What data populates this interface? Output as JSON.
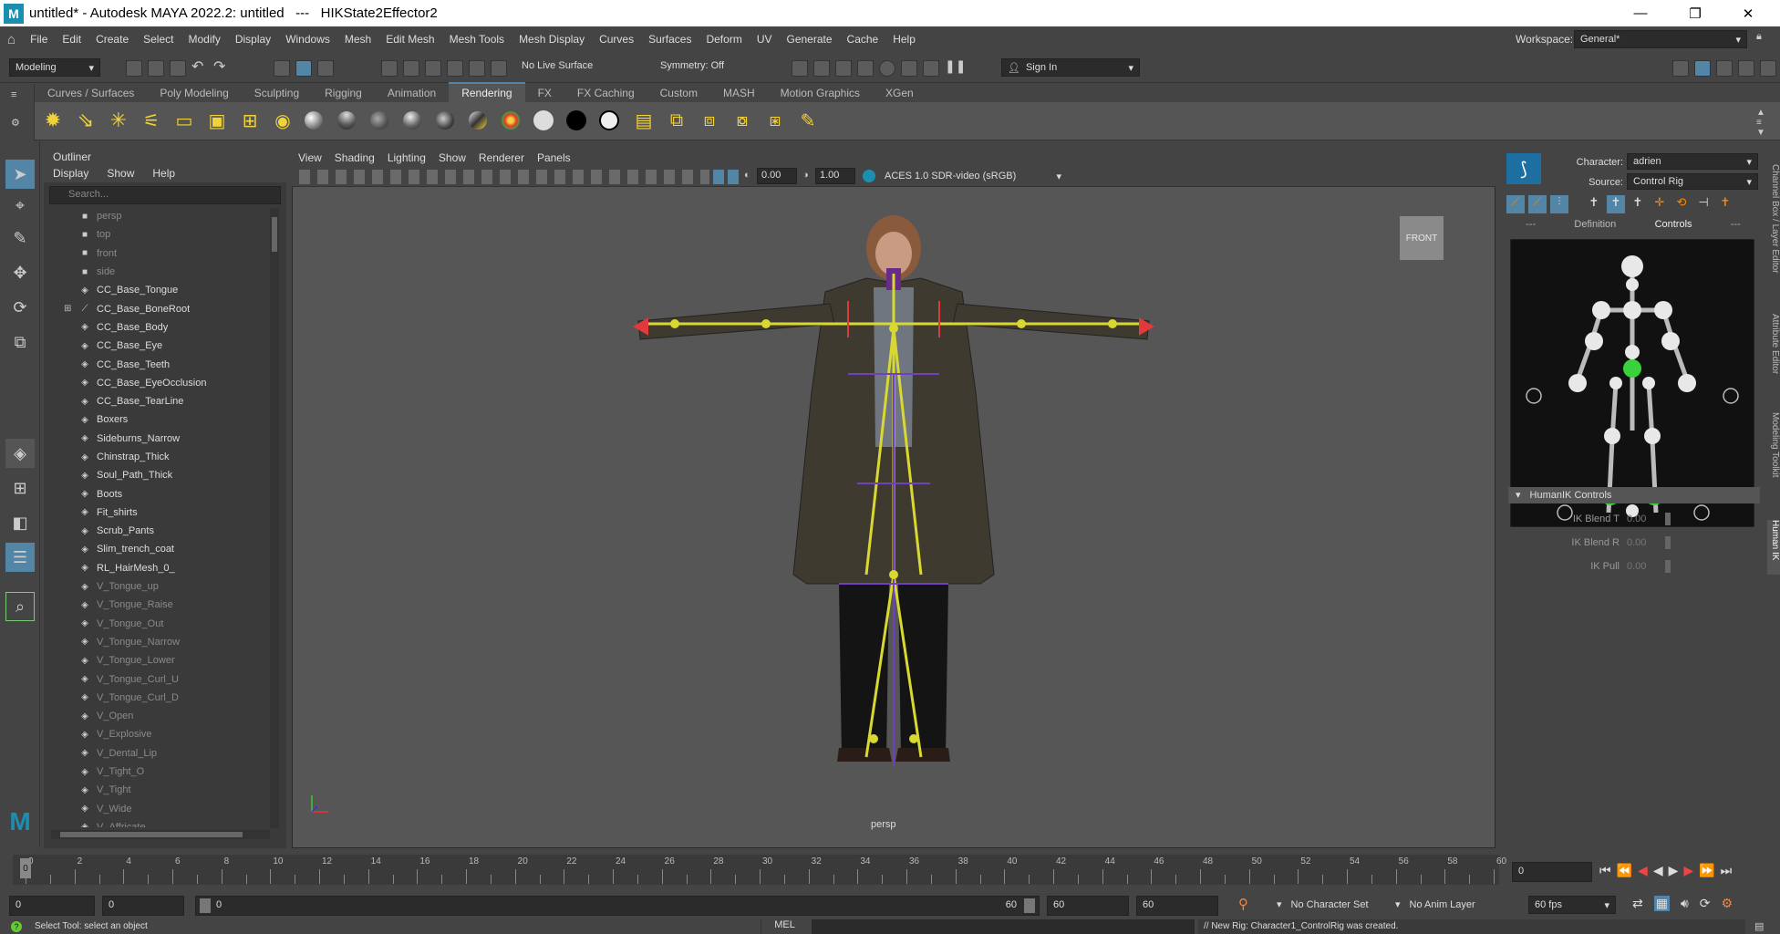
{
  "titlebar": {
    "logo": "M",
    "title": "untitled* - Autodesk MAYA 2022.2: untitled   ---   HIKState2Effector2",
    "minimize": "—",
    "maximize": "❐",
    "close": "✕"
  },
  "menus": [
    "File",
    "Edit",
    "Create",
    "Select",
    "Modify",
    "Display",
    "Windows",
    "Mesh",
    "Edit Mesh",
    "Mesh Tools",
    "Mesh Display",
    "Curves",
    "Surfaces",
    "Deform",
    "UV",
    "Generate",
    "Cache",
    "Help"
  ],
  "workspace": {
    "label": "Workspace:",
    "value": "General*"
  },
  "statusline": {
    "menuset": "Modeling",
    "live_surface": "No Live Surface",
    "symmetry": "Symmetry: Off",
    "sign_in": "Sign In"
  },
  "shelf_tabs": [
    "Curves / Surfaces",
    "Poly Modeling",
    "Sculpting",
    "Rigging",
    "Animation",
    "Rendering",
    "FX",
    "FX Caching",
    "Custom",
    "MASH",
    "Motion Graphics",
    "XGen"
  ],
  "active_shelf_tab": "Rendering",
  "outliner": {
    "title": "Outliner",
    "menu": [
      "Display",
      "Show",
      "Help"
    ],
    "search_placeholder": "Search...",
    "items": [
      {
        "name": "persp",
        "dim": true
      },
      {
        "name": "top",
        "dim": true
      },
      {
        "name": "front",
        "dim": true
      },
      {
        "name": "side",
        "dim": true
      },
      {
        "name": "CC_Base_Tongue"
      },
      {
        "name": "CC_Base_BoneRoot",
        "expand": true
      },
      {
        "name": "CC_Base_Body"
      },
      {
        "name": "CC_Base_Eye"
      },
      {
        "name": "CC_Base_Teeth"
      },
      {
        "name": "CC_Base_EyeOcclusion"
      },
      {
        "name": "CC_Base_TearLine"
      },
      {
        "name": "Boxers"
      },
      {
        "name": "Sideburns_Narrow"
      },
      {
        "name": "Chinstrap_Thick"
      },
      {
        "name": "Soul_Path_Thick"
      },
      {
        "name": "Boots"
      },
      {
        "name": "Fit_shirts"
      },
      {
        "name": "Scrub_Pants"
      },
      {
        "name": "Slim_trench_coat"
      },
      {
        "name": "RL_HairMesh_0_"
      },
      {
        "name": "V_Tongue_up",
        "dim": true
      },
      {
        "name": "V_Tongue_Raise",
        "dim": true
      },
      {
        "name": "V_Tongue_Out",
        "dim": true
      },
      {
        "name": "V_Tongue_Narrow",
        "dim": true
      },
      {
        "name": "V_Tongue_Lower",
        "dim": true
      },
      {
        "name": "V_Tongue_Curl_U",
        "dim": true
      },
      {
        "name": "V_Tongue_Curl_D",
        "dim": true
      },
      {
        "name": "V_Open",
        "dim": true
      },
      {
        "name": "V_Explosive",
        "dim": true
      },
      {
        "name": "V_Dental_Lip",
        "dim": true
      },
      {
        "name": "V_Tight_O",
        "dim": true
      },
      {
        "name": "V_Tight",
        "dim": true
      },
      {
        "name": "V_Wide",
        "dim": true
      },
      {
        "name": "V_Affricate",
        "dim": true
      }
    ]
  },
  "viewport": {
    "menu": [
      "View",
      "Shading",
      "Lighting",
      "Show",
      "Renderer",
      "Panels"
    ],
    "exposure": "0.00",
    "gamma": "1.00",
    "colorspace": "ACES 1.0 SDR-video (sRGB)",
    "view_cube": "FRONT",
    "camera": "persp"
  },
  "hik": {
    "character_label": "Character:",
    "character": "adrien",
    "source_label": "Source:",
    "source": "Control Rig",
    "tabs": [
      "---",
      "Definition",
      "Controls",
      "---"
    ],
    "active_tab": "Controls",
    "controls_header": "HumanIK Controls",
    "rows": [
      {
        "label": "IK Blend T",
        "value": "0.00"
      },
      {
        "label": "IK Blend R",
        "value": "0.00"
      },
      {
        "label": "IK Pull",
        "value": "0.00"
      }
    ]
  },
  "side_tabs": [
    "Channel Box / Layer Editor",
    "Attribute Editor",
    "Modeling Toolkit",
    "Human IK"
  ],
  "timeslider": {
    "ticks": [
      "0",
      "2",
      "4",
      "6",
      "8",
      "10",
      "12",
      "14",
      "16",
      "18",
      "20",
      "22",
      "24",
      "26",
      "28",
      "30",
      "32",
      "34",
      "36",
      "38",
      "40",
      "42",
      "44",
      "46",
      "48",
      "50",
      "52",
      "54",
      "56",
      "58",
      "60"
    ],
    "current_frame": "0"
  },
  "range": {
    "start": "0",
    "anim_start": "0",
    "range_start": "0",
    "range_end": "60",
    "end": "60",
    "anim_end": "60",
    "character_set": "No Character Set",
    "anim_layer": "No Anim Layer",
    "fps": "60 fps"
  },
  "cmdline": {
    "help": "Select Tool: select an object",
    "lang": "MEL",
    "result": "// New Rig: Character1_ControlRig was created."
  }
}
